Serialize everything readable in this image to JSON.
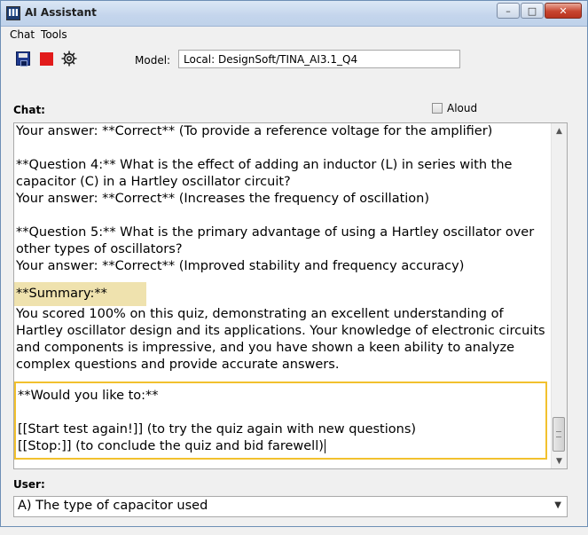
{
  "window": {
    "title": "AI Assistant"
  },
  "menu": [
    "Chat",
    "Tools"
  ],
  "toolbar": {
    "model_label": "Model:",
    "model_value": "Local: DesignSoft/TINA_AI3.1_Q4"
  },
  "chat": {
    "label": "Chat:",
    "aloud_label": "Aloud",
    "lines": [
      "Your answer: **Correct** (To provide a reference voltage for the amplifier)",
      "",
      "**Question 4:** What is the effect of adding an inductor (L) in series with the capacitor (C) in a Hartley oscillator circuit?",
      "Your answer: **Correct** (Increases the frequency of oscillation)",
      "",
      "**Question 5:** What is the primary advantage of using a Hartley oscillator over other types of oscillators?",
      "Your answer: **Correct** (Improved stability and frequency accuracy)"
    ],
    "summary_heading": "**Summary:**",
    "summary_text": "You scored 100% on this quiz, demonstrating an excellent understanding of Hartley oscillator design and its applications. Your knowledge of electronic circuits and components is impressive, and you have shown a keen ability to analyze complex questions and provide accurate answers.",
    "last_message": {
      "heading": "**Would you like to:**",
      "option1": "[[Start test again!]] (to try the quiz again with new questions)",
      "option2": "[[Stop:]] (to conclude the quiz and bid farewell)"
    }
  },
  "user": {
    "label": "User:",
    "selected": "A) The type of capacitor used"
  }
}
